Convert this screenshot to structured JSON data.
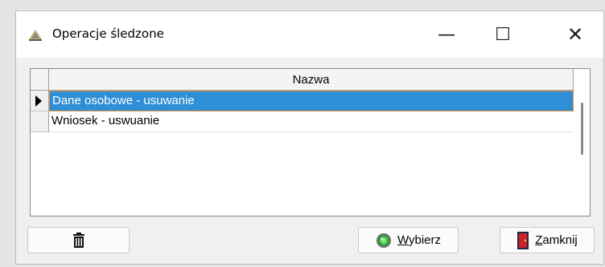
{
  "window": {
    "title": "Operacje śledzone",
    "controls": {
      "minimize": "—",
      "maximize": "☐",
      "close": "✕"
    }
  },
  "grid": {
    "column_header": "Nazwa",
    "rows": [
      {
        "name": "Dane osobowe - usuwanie",
        "selected": true
      },
      {
        "name": "Wniosek - uswuanie",
        "selected": false
      }
    ]
  },
  "buttons": {
    "delete": {
      "icon": "trash-icon"
    },
    "select": {
      "accel": "W",
      "rest": "ybierz",
      "icon": "green-light-icon"
    },
    "close": {
      "accel": "Z",
      "rest": "amknij",
      "icon": "door-exit-icon"
    }
  },
  "colors": {
    "selection": "#2e8ed6",
    "selection_border": "#e8903c"
  }
}
